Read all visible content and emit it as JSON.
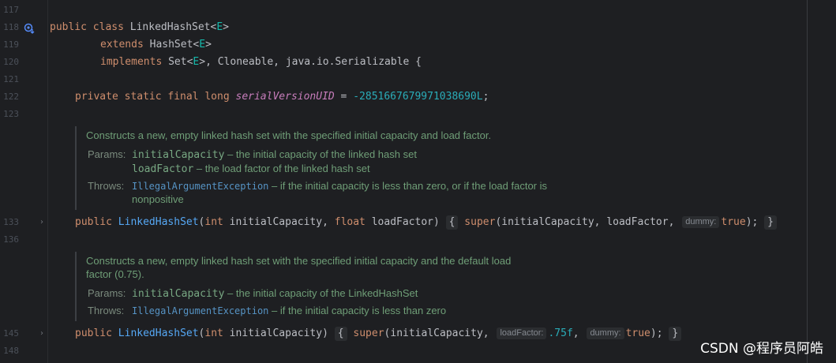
{
  "gutter": {
    "l117": "117",
    "l118": "118",
    "l119": "119",
    "l120": "120",
    "l121": "121",
    "l122": "122",
    "l123": "123",
    "l133": "133",
    "l136": "136",
    "l145": "145",
    "l148": "148"
  },
  "code": {
    "class_public": "public",
    "class_kw": "class",
    "class_name": "LinkedHashSet<",
    "class_tp": "E",
    "class_close": ">",
    "extends_kw": "extends",
    "extends_name": "HashSet<",
    "extends_tp": "E",
    "extends_close": ">",
    "implements_kw": "implements",
    "impl_set": "Set<",
    "impl_tp": "E",
    "impl_rest": ">, Cloneable, java.io.Serializable {",
    "field_mods": "private static final long",
    "field_name": "serialVersionUID",
    "field_eq": " = ",
    "field_value": "-2851667679971038690L",
    "field_semi": ";",
    "c1_public": "public",
    "c1_name": "LinkedHashSet",
    "c1_open": "(",
    "c1_int": "int",
    "c1_p1": " initialCapacity, ",
    "c1_float": "float",
    "c1_p2": " loadFactor)",
    "c1_lbrace": "{",
    "c1_super": "super",
    "c1_args": "(initialCapacity, loadFactor, ",
    "c1_hint": "dummy:",
    "c1_true": "true",
    "c1_end": ");",
    "c1_rbrace": "}",
    "c2_public": "public",
    "c2_name": "LinkedHashSet",
    "c2_open": "(",
    "c2_int": "int",
    "c2_p1": " initialCapacity)",
    "c2_lbrace": "{",
    "c2_super": "super",
    "c2_args": "(initialCapacity, ",
    "c2_hint1": "loadFactor:",
    "c2_val": ".75f",
    "c2_comma": ", ",
    "c2_hint2": "dummy:",
    "c2_true": "true",
    "c2_end": ");",
    "c2_rbrace": "}"
  },
  "doc1": {
    "description": "Constructs a new, empty linked hash set with the specified initial capacity and load factor.",
    "params_label": "Params:",
    "p1_name": "initialCapacity",
    "p1_desc": " – the initial capacity of the linked hash set",
    "p2_name": "loadFactor",
    "p2_desc": " – the load factor of the linked hash set",
    "throws_label": "Throws:",
    "throws_exc": "IllegalArgumentException",
    "throws_desc": " – if the initial capacity is less than zero, or if the load factor is",
    "throws_desc2": "nonpositive"
  },
  "doc2": {
    "description1": "Constructs a new, empty linked hash set with the specified initial capacity and the default load",
    "description2": "factor (0.75).",
    "params_label": "Params:",
    "p1_name": "initialCapacity",
    "p1_desc": " – the initial capacity of the LinkedHashSet",
    "throws_label": "Throws:",
    "throws_exc": "IllegalArgumentException",
    "throws_desc": " – if the initial capacity is less than zero"
  },
  "icons": {
    "gutter_override": "override-icon",
    "fold": "chevron-right-icon"
  },
  "watermark": "CSDN @程序员阿皓",
  "colors": {
    "background": "#1e1f22",
    "keyword": "#cf8e6d",
    "type_param": "#16baac",
    "method": "#56a8f5",
    "static_field": "#c77dbb",
    "number": "#2aacb8",
    "doc_text": "#6f9e77"
  }
}
